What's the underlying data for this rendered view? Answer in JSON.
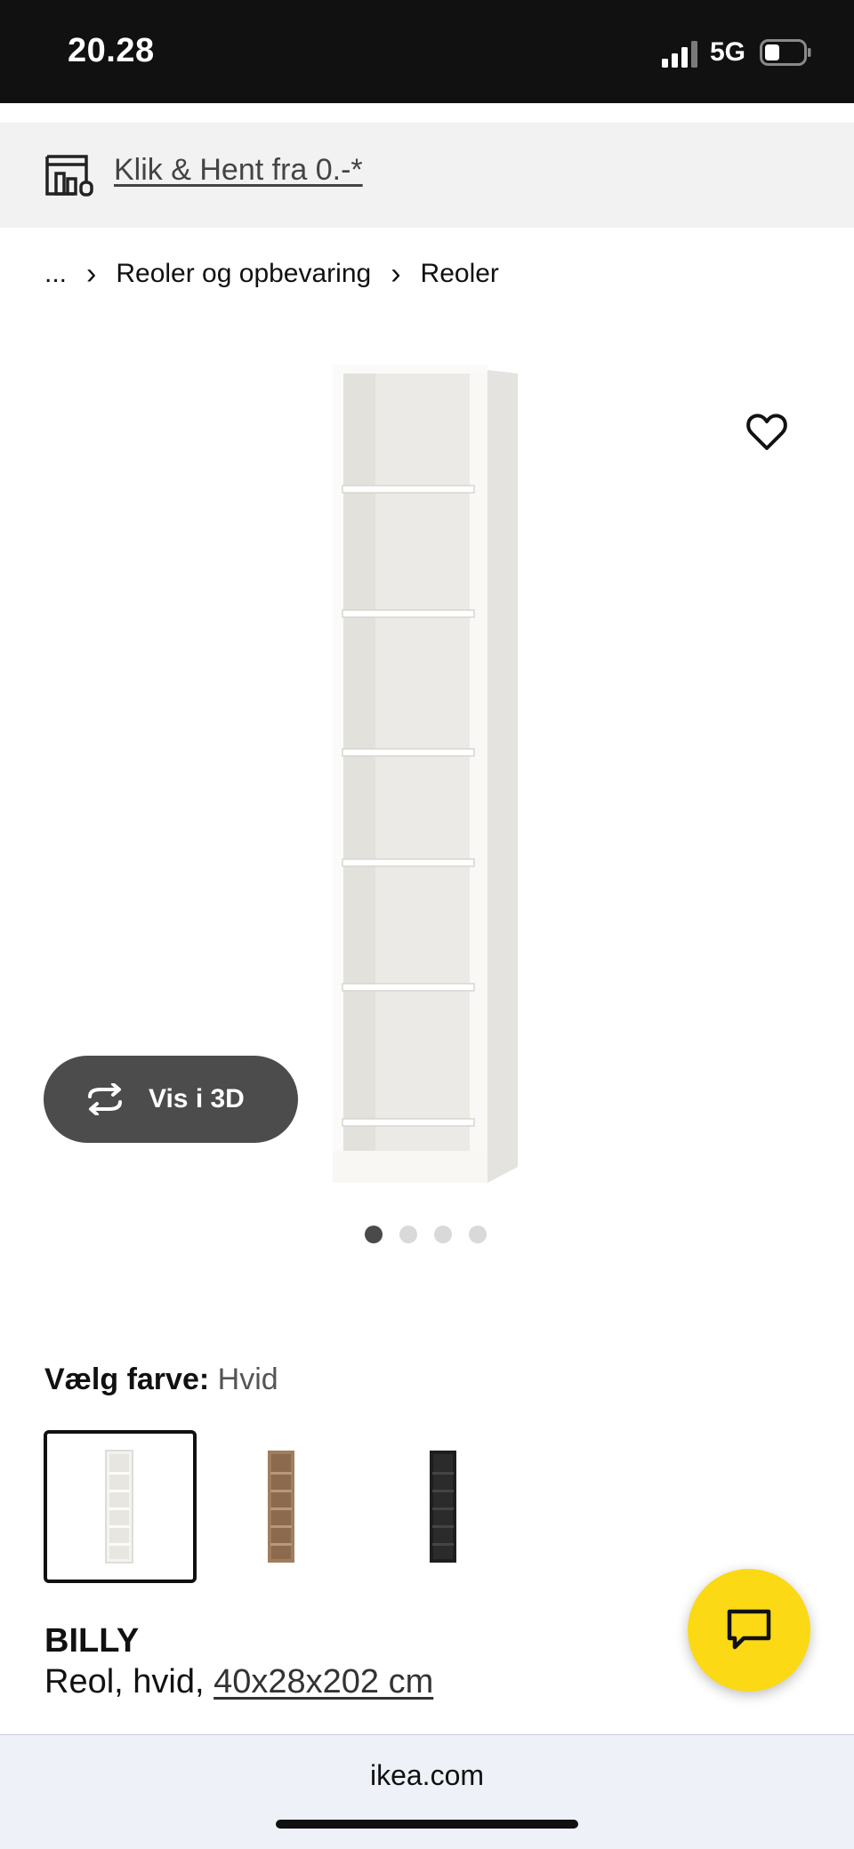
{
  "status": {
    "time": "20.28",
    "network": "5G"
  },
  "promo": {
    "link": "Klik & Hent fra 0.-*",
    "icon": "store-pickup-icon"
  },
  "breadcrumb": {
    "ellipsis": "...",
    "items": [
      "Reoler og opbevaring",
      "Reoler"
    ]
  },
  "gallery": {
    "view3d_label": "Vis i 3D",
    "image_count": 4,
    "active_index": 0
  },
  "color": {
    "label": "Vælg farve:",
    "selected": "Hvid",
    "swatches": [
      "#f1f0ec",
      "#a07e5e",
      "#1e1e1e"
    ]
  },
  "product": {
    "name": "BILLY",
    "desc_prefix": "Reol, hvid,",
    "dimensions": "40x28x202 cm"
  },
  "browser": {
    "url": "ikea.com"
  },
  "colors": {
    "accent": "#fbd914",
    "dark_button": "#4c4c4c"
  }
}
